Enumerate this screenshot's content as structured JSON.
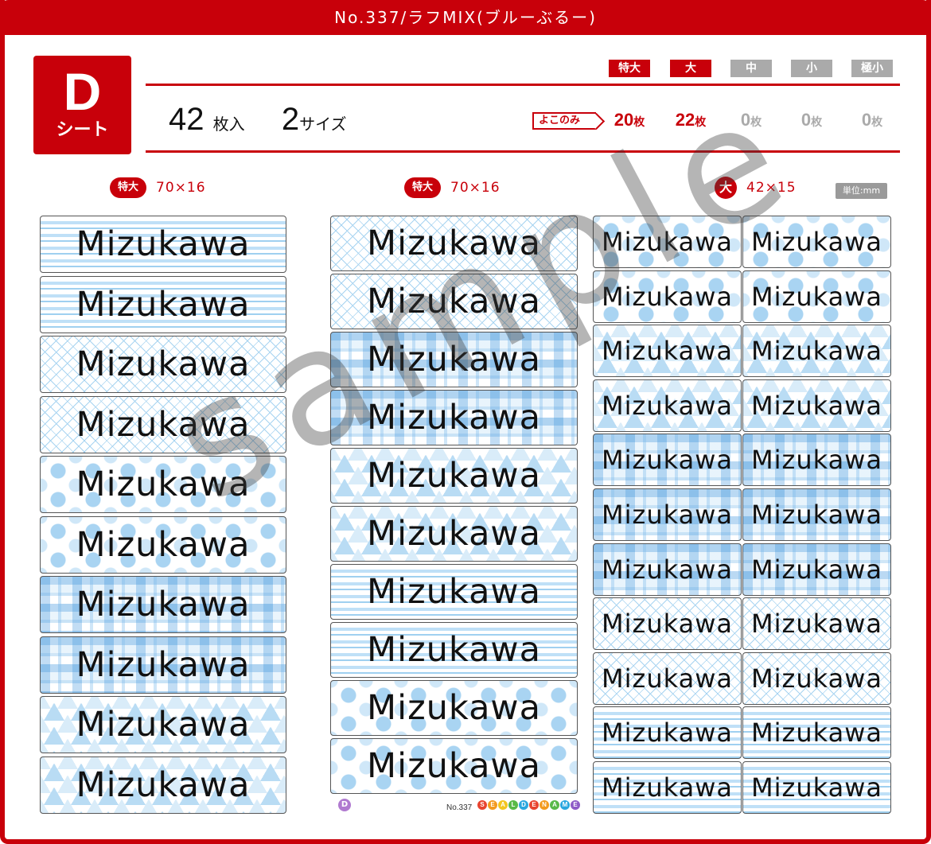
{
  "header": {
    "title": "No.337/ラフMIX(ブルーぶるー)"
  },
  "sheet": {
    "letter": "D",
    "label": "シート",
    "count_num": "42",
    "count_unit": "枚入",
    "sizes_num": "2",
    "sizes_unit": "サイズ"
  },
  "sizes": [
    {
      "label": "特大",
      "count": "20",
      "active": true
    },
    {
      "label": "大",
      "count": "22",
      "active": true
    },
    {
      "label": "中",
      "count": "0",
      "active": false
    },
    {
      "label": "小",
      "count": "0",
      "active": false
    },
    {
      "label": "極小",
      "count": "0",
      "active": false
    }
  ],
  "count_unit": "枚",
  "yoko_label": "よこのみ",
  "colors": {
    "accent": "#c8000a",
    "inactive": "#aaaaaa"
  },
  "columns": [
    {
      "badge": "特大",
      "dim": "70×16"
    },
    {
      "badge": "特大",
      "dim": "70×16"
    },
    {
      "badge": "大",
      "dim": "42×15"
    }
  ],
  "unit_badge": "単位:mm",
  "label_name": "Mizukawa",
  "column1_patterns": [
    "stripe",
    "stripe",
    "cross",
    "cross",
    "dots",
    "dots",
    "check",
    "check",
    "tri",
    "tri"
  ],
  "column2_patterns": [
    "cross",
    "cross",
    "check",
    "check",
    "tri",
    "tri",
    "stripe",
    "stripe",
    "dots",
    "dots"
  ],
  "column3_patterns": [
    "dots",
    "dots",
    "tri",
    "tri",
    "check",
    "check",
    "check",
    "cross",
    "cross",
    "stripe",
    "stripe"
  ],
  "watermark": "sample",
  "footer": {
    "sheet_letter": "D",
    "number": "No.337",
    "brand_letters": [
      "S",
      "E",
      "A",
      "L",
      "D",
      "E",
      "N",
      "A",
      "M",
      "E"
    ]
  }
}
